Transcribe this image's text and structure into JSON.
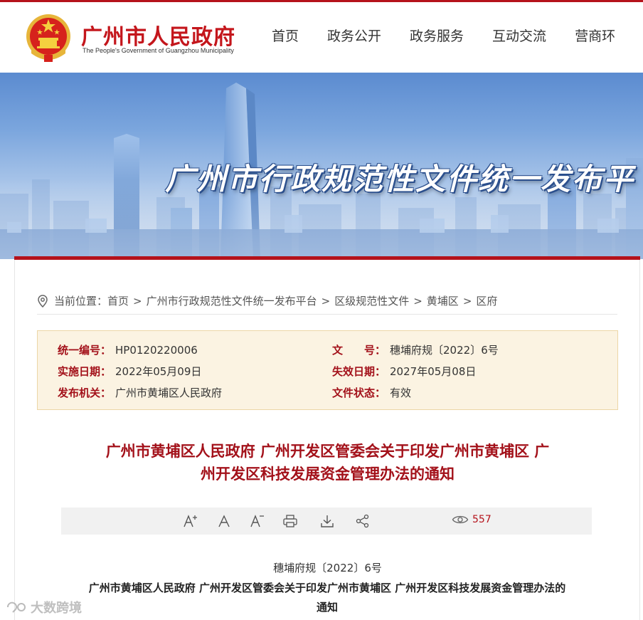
{
  "header": {
    "site_title": "广州市人民政府",
    "site_subtitle": "The People's Government of Guangzhou Municipality",
    "emblem_icon": "national-emblem-icon",
    "nav": [
      "首页",
      "政务公开",
      "政务服务",
      "互动交流",
      "营商环"
    ]
  },
  "banner": {
    "title": "广州市行政规范性文件统一发布平"
  },
  "breadcrumb": {
    "prefix": "当前位置：",
    "items": [
      "首页",
      "广州市行政规范性文件统一发布平台",
      "区级规范性文件",
      "黄埔区",
      "区府"
    ],
    "separator": ">"
  },
  "info": {
    "serial_label": "统一编号：",
    "serial_value": "HP0120220006",
    "docno_label": "文　　号：",
    "docno_value": "穗埔府规〔2022〕6号",
    "effective_label": "实施日期：",
    "effective_value": "2022年05月09日",
    "expire_label": "失效日期：",
    "expire_value": "2027年05月08日",
    "issuer_label": "发布机关：",
    "issuer_value": "广州市黄埔区人民政府",
    "status_label": "文件状态：",
    "status_value": "有效"
  },
  "document": {
    "title_line1": "广州市黄埔区人民政府 广州开发区管委会关于印发广州市黄埔区 广",
    "title_line2": "州开发区科技发展资金管理办法的通知",
    "number": "穗埔府规〔2022〕6号",
    "body_title_line1": "广州市黄埔区人民政府 广州开发区管委会关于印发广州市黄埔区 广州开发区科技发展资金管理办法的",
    "body_title_line2": "通知"
  },
  "toolbar": {
    "view_count": "557",
    "icons": [
      "font-increase-icon",
      "font-normal-icon",
      "font-decrease-icon",
      "print-icon",
      "download-icon",
      "share-icon",
      "eye-icon"
    ]
  },
  "watermark": {
    "text": "大数跨境"
  },
  "colors": {
    "brand_red": "#b5121b",
    "label_red": "#a3111a",
    "info_bg": "#fbf3e2"
  }
}
